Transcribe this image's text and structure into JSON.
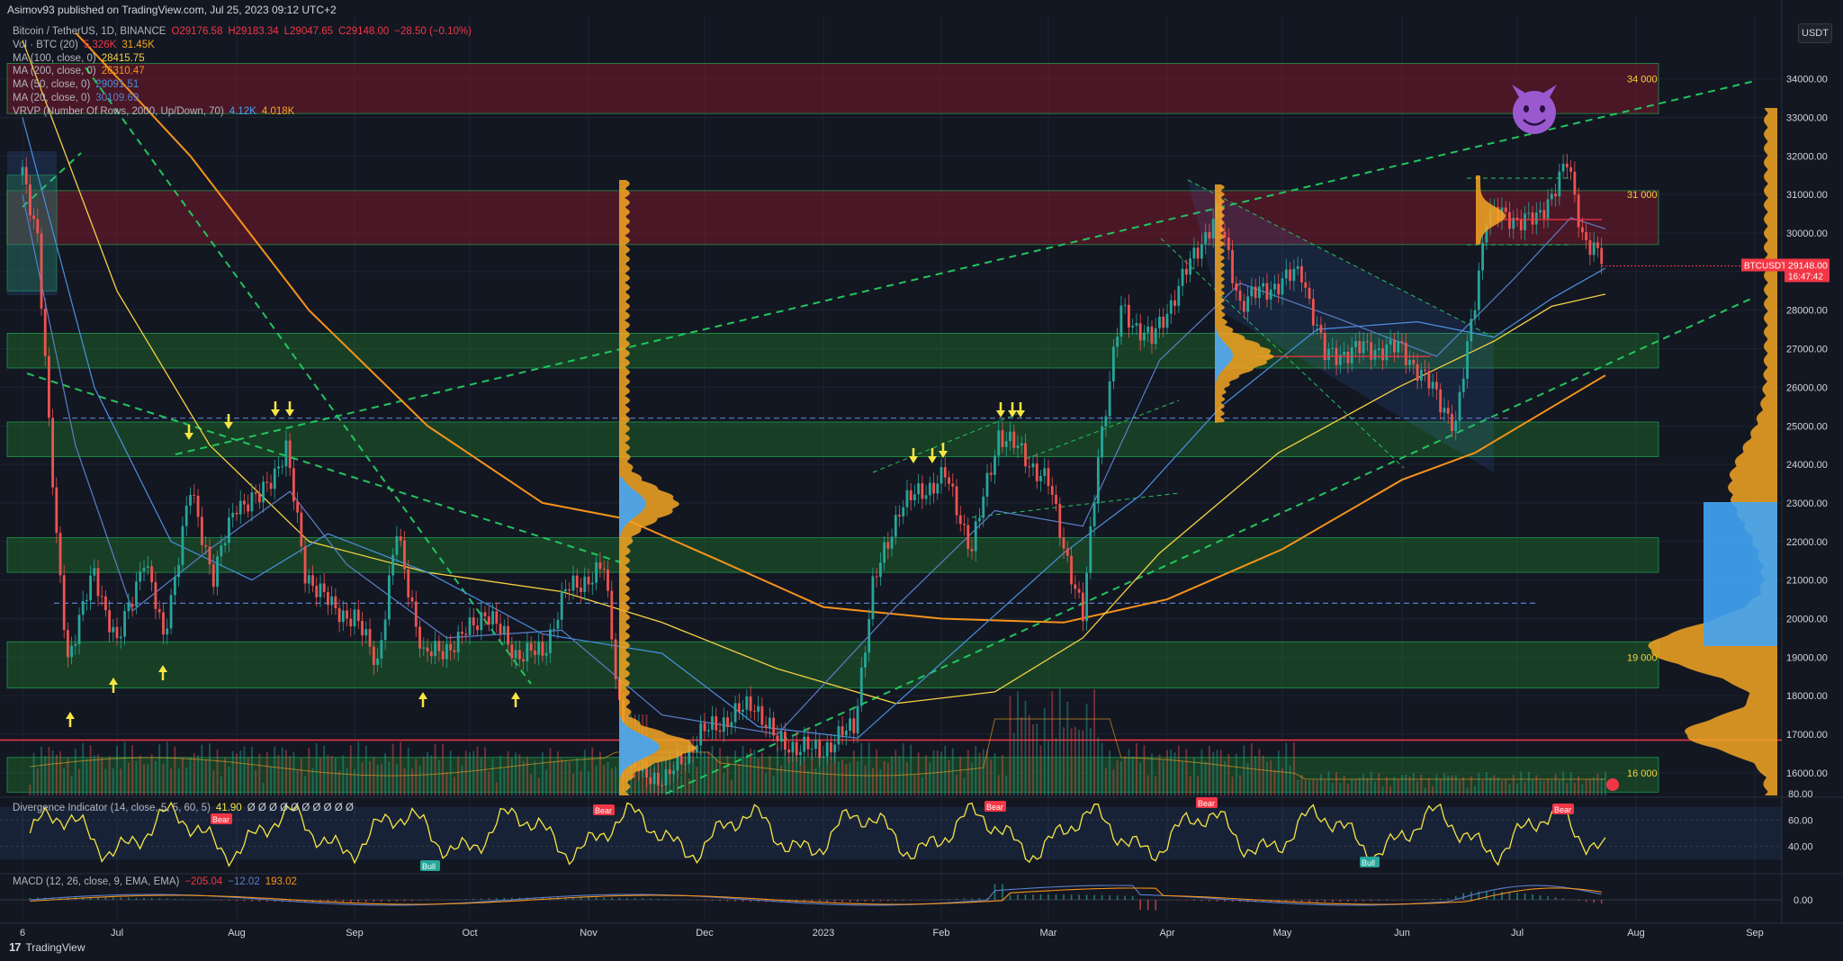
{
  "header": {
    "publisher": "Asimov93 published on TradingView.com, Jul 25, 2023 09:12 UTC+2"
  },
  "legend": [
    {
      "name": "Bitcoin / TetherUS, 1D, BINANCE",
      "values": [
        "O29176.58",
        "H29183.34",
        "L29047.65",
        "C29148.00",
        "−28.50 (−0.10%)"
      ],
      "colors": [
        "#f23645",
        "#f23645",
        "#f23645",
        "#f23645",
        "#f23645"
      ]
    },
    {
      "name": "Vol · BTC (20)",
      "values": [
        "5.326K",
        "31.45K"
      ],
      "colors": [
        "#f23645",
        "#f5a623"
      ]
    },
    {
      "name": "MA (100, close, 0)",
      "values": [
        "28415.75"
      ],
      "colors": [
        "#f5d142"
      ]
    },
    {
      "name": "MA (200, close, 0)",
      "values": [
        "26310.47"
      ],
      "colors": [
        "#f7931a"
      ]
    },
    {
      "name": "MA (50, close, 0)",
      "values": [
        "29091.51"
      ],
      "colors": [
        "#4a90e2"
      ]
    },
    {
      "name": "MA (20, close, 0)",
      "values": [
        "30109.69"
      ],
      "colors": [
        "#5b7ec8"
      ]
    },
    {
      "name": "VRVP (Number Of Rows, 2000, Up/Down, 70)",
      "values": [
        "4.12K",
        "4.018K"
      ],
      "colors": [
        "#42a5f5",
        "#f5a623"
      ]
    }
  ],
  "usdt_label": "USDT",
  "price_tag": {
    "symbol": "BTCUSDT",
    "price": "29148.00",
    "countdown": "16:47:42"
  },
  "zone_labels": [
    "34 000",
    "31 000",
    "19 000",
    "16 000"
  ],
  "divergence_indicator": {
    "title": "Divergence Indicator (14, close, 5, 5, 60, 5)",
    "value": "41.90",
    "extras": "Ø Ø Ø Ø Ø Ø Ø Ø Ø Ø",
    "axis": [
      "80.00",
      "60.00",
      "40.00"
    ],
    "bear_label": "Bear",
    "bull_label": "Bull"
  },
  "macd": {
    "title": "MACD (12, 26, close, 9, EMA, EMA)",
    "values": [
      "−205.04",
      "−12.02",
      "193.02"
    ],
    "colors": [
      "#f23645",
      "#5b7ec8",
      "#f7931a"
    ],
    "axis": [
      "0.00"
    ]
  },
  "footer": {
    "brand": "TradingView"
  },
  "chart_data": {
    "type": "candlestick",
    "symbol": "BTCUSDT",
    "exchange": "BINANCE",
    "timeframe": "1D",
    "x_tick_labels": [
      "6",
      "Jul",
      "Aug",
      "Sep",
      "Oct",
      "Nov",
      "Dec",
      "2023",
      "Feb",
      "Mar",
      "Apr",
      "May",
      "Jun",
      "Jul",
      "Aug",
      "Sep"
    ],
    "y_tick_labels": [
      "34000.00",
      "33000.00",
      "32000.00",
      "31000.00",
      "30000.00",
      "29000.00",
      "28000.00",
      "27000.00",
      "26000.00",
      "25000.00",
      "24000.00",
      "23000.00",
      "22000.00",
      "21000.00",
      "20000.00",
      "19000.00",
      "18000.00",
      "17000.00",
      "16000.00"
    ],
    "ylim": [
      15450,
      35300
    ],
    "grid": true,
    "last_close": 29148.0,
    "price_series": [
      [
        "2022-06-06",
        31500
      ],
      [
        "2022-06-10",
        30000
      ],
      [
        "2022-06-13",
        25000
      ],
      [
        "2022-06-15",
        22000
      ],
      [
        "2022-06-18",
        19000
      ],
      [
        "2022-06-25",
        21200
      ],
      [
        "2022-07-01",
        19300
      ],
      [
        "2022-07-08",
        21600
      ],
      [
        "2022-07-13",
        19500
      ],
      [
        "2022-07-20",
        23300
      ],
      [
        "2022-07-26",
        21100
      ],
      [
        "2022-08-01",
        23000
      ],
      [
        "2022-08-07",
        23100
      ],
      [
        "2022-08-14",
        24400
      ],
      [
        "2022-08-19",
        21200
      ],
      [
        "2022-08-26",
        20300
      ],
      [
        "2022-09-01",
        20000
      ],
      [
        "2022-09-07",
        18900
      ],
      [
        "2022-09-12",
        22200
      ],
      [
        "2022-09-19",
        19000
      ],
      [
        "2022-09-28",
        19400
      ],
      [
        "2022-10-05",
        20200
      ],
      [
        "2022-10-13",
        19100
      ],
      [
        "2022-10-20",
        19100
      ],
      [
        "2022-10-26",
        20700
      ],
      [
        "2022-11-05",
        21300
      ],
      [
        "2022-11-09",
        17800
      ],
      [
        "2022-11-10",
        16200
      ],
      [
        "2022-11-21",
        15800
      ],
      [
        "2022-11-30",
        17000
      ],
      [
        "2022-12-14",
        17800
      ],
      [
        "2022-12-20",
        16800
      ],
      [
        "2022-12-31",
        16550
      ],
      [
        "2023-01-09",
        17200
      ],
      [
        "2023-01-14",
        20800
      ],
      [
        "2023-01-21",
        22900
      ],
      [
        "2023-02-02",
        23700
      ],
      [
        "2023-02-09",
        21800
      ],
      [
        "2023-02-16",
        24800
      ],
      [
        "2023-02-21",
        24400
      ],
      [
        "2023-03-01",
        23500
      ],
      [
        "2023-03-10",
        20000
      ],
      [
        "2023-03-14",
        24300
      ],
      [
        "2023-03-20",
        28000
      ],
      [
        "2023-03-28",
        27200
      ],
      [
        "2023-04-10",
        29800
      ],
      [
        "2023-04-14",
        30500
      ],
      [
        "2023-04-20",
        28200
      ],
      [
        "2023-04-26",
        28500
      ],
      [
        "2023-05-06",
        29000
      ],
      [
        "2023-05-12",
        26800
      ],
      [
        "2023-05-22",
        27000
      ],
      [
        "2023-06-01",
        27000
      ],
      [
        "2023-06-10",
        25800
      ],
      [
        "2023-06-15",
        25000
      ],
      [
        "2023-06-20",
        28300
      ],
      [
        "2023-06-23",
        30500
      ],
      [
        "2023-07-06",
        30300
      ],
      [
        "2023-07-14",
        31800
      ],
      [
        "2023-07-18",
        30000
      ],
      [
        "2023-07-24",
        29148
      ]
    ],
    "resistance_zones": [
      [
        33100,
        34400
      ],
      [
        29700,
        31100
      ]
    ],
    "support_zones": [
      [
        26500,
        27400
      ],
      [
        24200,
        25100
      ],
      [
        21200,
        22100
      ],
      [
        18200,
        19400
      ],
      [
        15500,
        16400
      ]
    ],
    "horizontal_levels": [
      {
        "price": 16850,
        "style": "solid",
        "color": "#f23645"
      },
      {
        "price": 25200,
        "style": "dashed",
        "color": "#5b7ec8"
      },
      {
        "price": 20400,
        "style": "dashed",
        "color": "#5b7ec8"
      }
    ],
    "moving_averages": [
      {
        "name": "MA (100, close, 0)",
        "last": 28415.75
      },
      {
        "name": "MA (200, close, 0)",
        "last": 26310.47
      },
      {
        "name": "MA (50, close, 0)",
        "last": 29091.51
      },
      {
        "name": "MA (20, close, 0)",
        "last": 30109.69
      }
    ]
  }
}
